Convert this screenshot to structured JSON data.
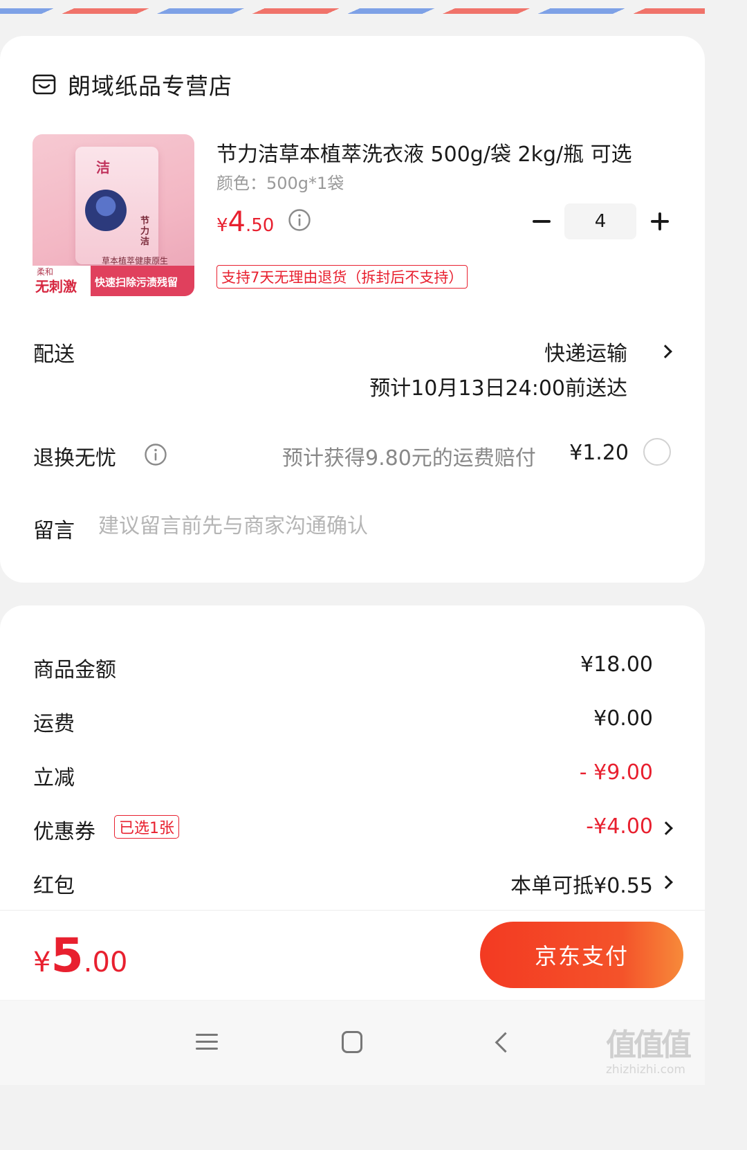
{
  "store": {
    "name": "朗域纸品专营店",
    "icon": "store-icon"
  },
  "product": {
    "image": {
      "brand": "洁",
      "name_vertical": "节力洁",
      "soft": "柔和",
      "no_irritation": "无刺激",
      "herbal": "草本植萃健康原生",
      "remove_stains": "快速扫除污渍残留"
    },
    "title": "节力洁草本植萃洗衣液 500g/袋  2kg/瓶 可选",
    "spec": "颜色：500g*1袋",
    "price": {
      "symbol": "¥",
      "integer": "4",
      "decimal": ".50"
    },
    "quantity": "4",
    "return_policy": "支持7天无理由退货（拆封后不支持）"
  },
  "delivery": {
    "label": "配送",
    "method": "快递运输",
    "eta": "预计10月13日24:00前送达"
  },
  "worry_free": {
    "label": "退换无忧",
    "description": "预计获得9.80元的运费赔付",
    "price": "¥1.20"
  },
  "message": {
    "label": "留言",
    "placeholder": "建议留言前先与商家沟通确认"
  },
  "summary": {
    "goods": {
      "label": "商品金额",
      "value": "¥18.00"
    },
    "shipping": {
      "label": "运费",
      "value": "¥0.00"
    },
    "discount": {
      "label": "立减",
      "value": "- ¥9.00"
    },
    "coupon": {
      "label": "优惠券",
      "tag": "已选1张",
      "value": "-¥4.00"
    },
    "red_packet": {
      "label": "红包",
      "value": "本单可抵¥0.55"
    }
  },
  "footer": {
    "total": {
      "symbol": "¥",
      "integer": "5",
      "decimal": ".00"
    },
    "pay_label": "京东支付"
  },
  "watermark": {
    "logo": "值值值",
    "site": "zhizhizhi.com"
  },
  "colors": {
    "accent": "#e8202f",
    "pay_gradient_start": "#f33a22",
    "pay_gradient_end": "#f78a3a"
  }
}
